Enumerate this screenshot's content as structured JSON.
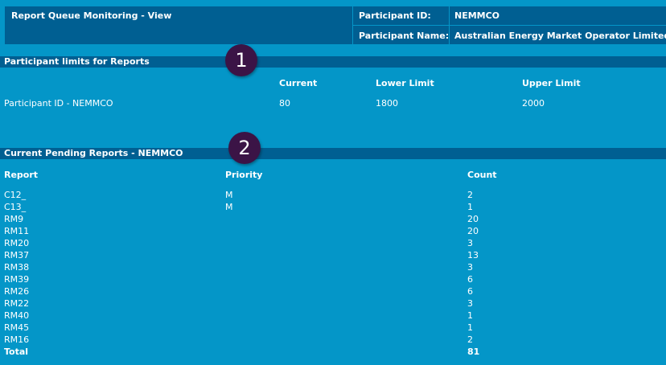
{
  "header": {
    "title": "Report Queue Monitoring - View",
    "participant_id_label": "Participant ID:",
    "participant_id_value": "NEMMCO",
    "participant_name_label": "Participant Name:",
    "participant_name_value": "Australian Energy Market Operator Limited"
  },
  "limits": {
    "section_title": "Participant limits for Reports",
    "marker": "1",
    "columns": {
      "current": "Current",
      "lower": "Lower Limit",
      "upper": "Upper Limit"
    },
    "row": {
      "label": "Participant ID - NEMMCO",
      "current": "80",
      "lower": "1800",
      "upper": "2000"
    }
  },
  "pending": {
    "section_title": "Current Pending Reports - NEMMCO",
    "marker": "2",
    "columns": {
      "report": "Report",
      "priority": "Priority",
      "count": "Count"
    },
    "rows": [
      {
        "report": "C12_",
        "priority": "M",
        "count": "2"
      },
      {
        "report": "C13_",
        "priority": "M",
        "count": "1"
      },
      {
        "report": "RM9",
        "priority": "",
        "count": "20"
      },
      {
        "report": "RM11",
        "priority": "",
        "count": "20"
      },
      {
        "report": "RM20",
        "priority": "",
        "count": "3"
      },
      {
        "report": "RM37",
        "priority": "",
        "count": "13"
      },
      {
        "report": "RM38",
        "priority": "",
        "count": "3"
      },
      {
        "report": "RM39",
        "priority": "",
        "count": "6"
      },
      {
        "report": "RM26",
        "priority": "",
        "count": "6"
      },
      {
        "report": "RM22",
        "priority": "",
        "count": "3"
      },
      {
        "report": "RM40",
        "priority": "",
        "count": "1"
      },
      {
        "report": "RM45",
        "priority": "",
        "count": "1"
      },
      {
        "report": "RM16",
        "priority": "",
        "count": "2"
      }
    ],
    "total": {
      "label": "Total",
      "count": "81"
    }
  },
  "colors": {
    "background": "#0496c8",
    "header_bar": "#005f92",
    "marker": "#3b1446",
    "text": "#ffffff"
  }
}
